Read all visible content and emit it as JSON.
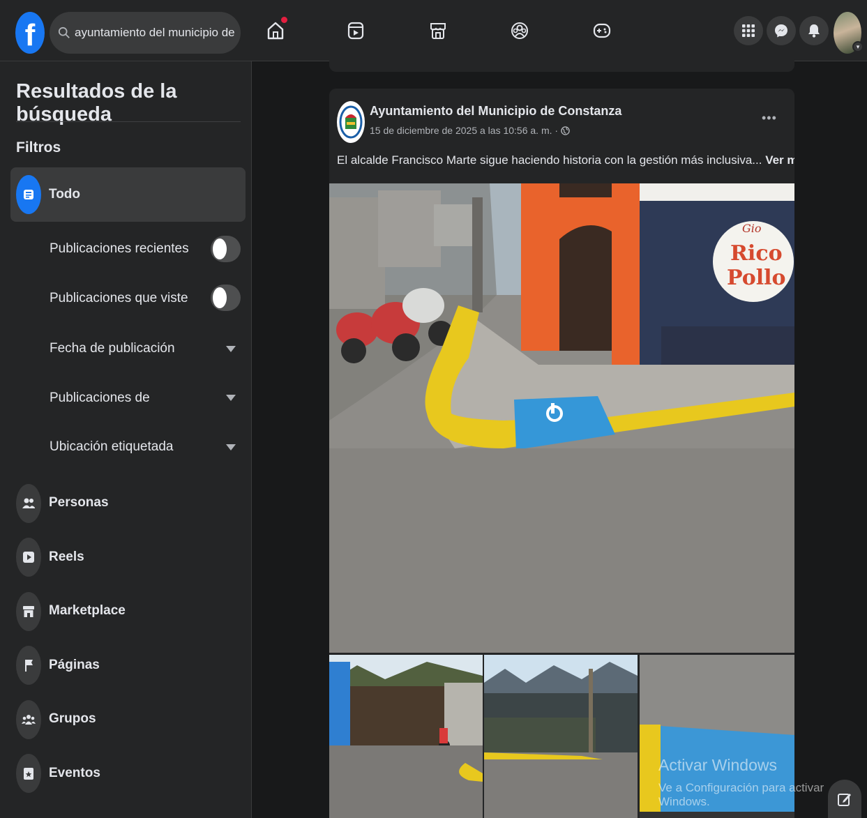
{
  "topbar": {
    "logo_letter": "f",
    "search_value": "ayuntamiento del municipio de con",
    "nav_icons": [
      "home-icon",
      "video-icon",
      "marketplace-icon",
      "groups-icon",
      "gaming-icon"
    ],
    "right_icons": [
      "menu-grid-icon",
      "messenger-icon",
      "notifications-icon"
    ],
    "accent": "#1877f2",
    "notification_dot": "#e41e3f"
  },
  "sidebar": {
    "title": "Resultados de la búsqueda",
    "filters_label": "Filtros",
    "todo_label": "Todo",
    "toggles": [
      {
        "label": "Publicaciones recientes",
        "on": false
      },
      {
        "label": "Publicaciones que viste",
        "on": false
      }
    ],
    "dropdowns": [
      {
        "label": "Fecha de publicación"
      },
      {
        "label": "Publicaciones de"
      },
      {
        "label": "Ubicación etiquetada"
      }
    ],
    "categories": [
      {
        "label": "Personas",
        "icon": "people-icon"
      },
      {
        "label": "Reels",
        "icon": "reels-icon"
      },
      {
        "label": "Marketplace",
        "icon": "shop-icon"
      },
      {
        "label": "Páginas",
        "icon": "flag-icon"
      },
      {
        "label": "Grupos",
        "icon": "groups-icon"
      },
      {
        "label": "Eventos",
        "icon": "calendar-star-icon"
      }
    ]
  },
  "post": {
    "author": "Ayuntamiento del Municipio de Constanza",
    "date": "15 de diciembre de 2025 a las 10:56 a. m. ·",
    "more": "•••",
    "text": "El alcalde Francisco Marte sigue haciendo historia con la gestión más inclusiva...",
    "see_more": "Ver más",
    "sign_text": [
      "Gio",
      "Rico",
      "Pollo"
    ]
  },
  "system": {
    "watermark_title": "Activar Windows",
    "watermark_subtitle": "Ve a Configuración para activar Windows."
  }
}
